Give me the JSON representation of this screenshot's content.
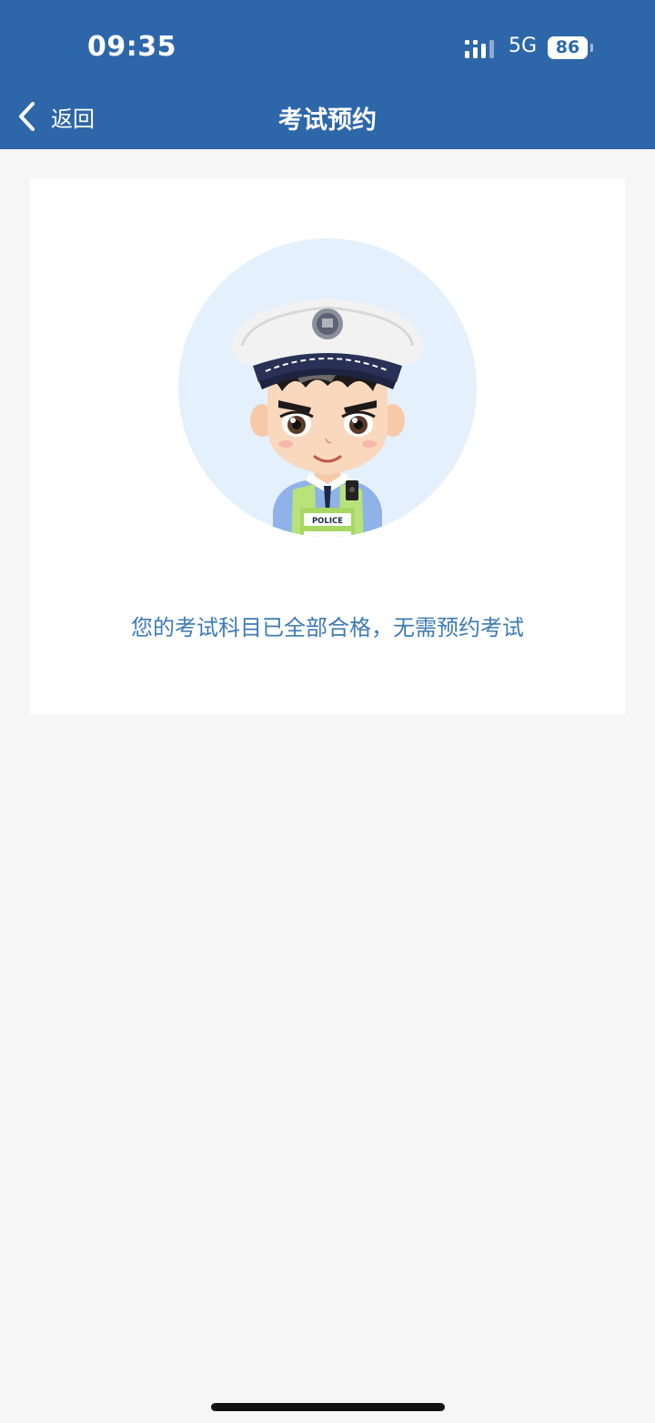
{
  "status_bar": {
    "time": "09:35",
    "network": "5G",
    "battery": "86",
    "signal_icon": "signal-bars-icon",
    "battery_icon": "battery-icon"
  },
  "nav": {
    "back_label": "返回",
    "back_icon": "chevron-left-icon",
    "title": "考试预约"
  },
  "card": {
    "illustration": "police-officer-avatar",
    "badge_text": "POLICE",
    "message": "您的考试科目已全部合格，无需预约考试"
  },
  "colors": {
    "header_bg": "#2e67a9",
    "page_bg": "#f6f6f6",
    "card_bg": "#ffffff",
    "message_text": "#3d7bb5",
    "avatar_circle": "#e4f1fc"
  }
}
